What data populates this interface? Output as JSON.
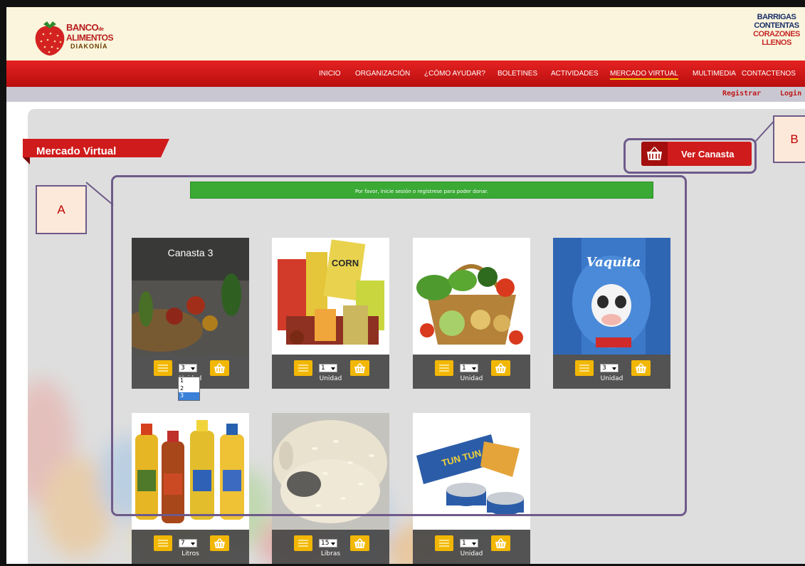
{
  "header": {
    "logo": {
      "line1": "BANCO",
      "line1_suffix": "de",
      "line2": "ALIMENTOS",
      "line3": "DIAKONÍA"
    },
    "brand_right": [
      "BARRIGAS",
      "CONTENTAS",
      "CORAZONES",
      "LLENOS"
    ]
  },
  "nav": {
    "items": [
      "INICIO",
      "ORGANIZACIÓN",
      "¿CÓMO AYUDAR?",
      "BOLETINES",
      "ACTIVIDADES",
      "MERCADO VIRTUAL",
      "MULTIMEDIA",
      "CONTACTENOS"
    ],
    "active": "MERCADO VIRTUAL"
  },
  "user_links": {
    "register": "Registrar",
    "login": "Login"
  },
  "page_title": "Mercado Virtual",
  "cart_button": {
    "label": "Ver Canasta",
    "icon": "basket-icon"
  },
  "notice": "Por favor, inicie sesión o regístrese para poder donar.",
  "products": [
    {
      "title": "Canasta 3",
      "image": "vegetable-basket-photo",
      "qty": "3",
      "unit": "Unidad"
    },
    {
      "image": "cereal-groceries-photo",
      "qty": "1",
      "unit": "Unidad"
    },
    {
      "image": "fruit-basket-photo",
      "qty": "1",
      "unit": "Unidad"
    },
    {
      "image": "milk-powder-photo",
      "qty": "3",
      "unit": "Unidad"
    },
    {
      "image": "cooking-oil-photo",
      "qty": "7",
      "unit": "Litros"
    },
    {
      "image": "rice-photo",
      "qty": "15",
      "unit": "Libras"
    },
    {
      "image": "canned-tuna-photo",
      "qty": "1",
      "unit": "Unidad"
    }
  ],
  "qty_dropdown": {
    "options": [
      "1",
      "2",
      "3"
    ],
    "selected": "3"
  },
  "annotations": {
    "a": "A",
    "b": "B"
  },
  "colors": {
    "nav_red": "#d71a1a",
    "accent_yellow": "#f2b705",
    "notice_green": "#3aaa35",
    "annotation_purple": "#6e5a8a"
  }
}
